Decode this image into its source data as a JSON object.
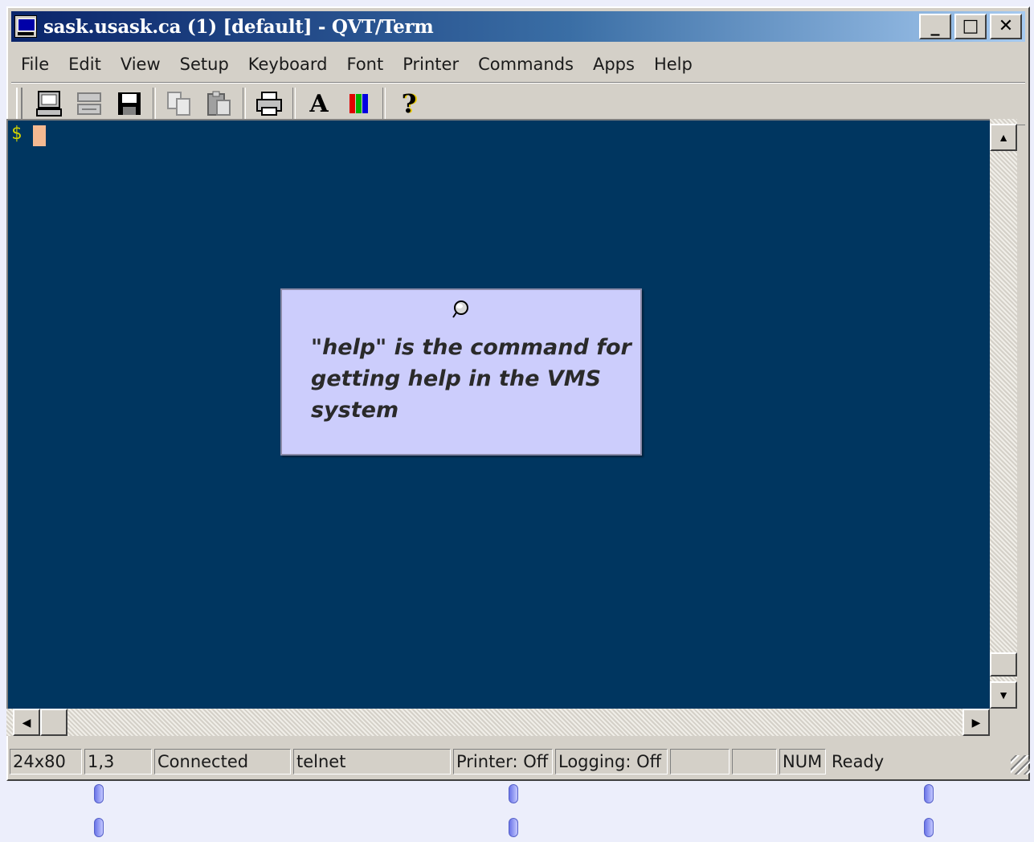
{
  "window": {
    "title": "sask.usask.ca (1) [default] - QVT/Term",
    "controls": {
      "minimize": "_",
      "maximize": "□",
      "close": "✕"
    }
  },
  "menu": [
    "File",
    "Edit",
    "View",
    "Setup",
    "Keyboard",
    "Font",
    "Printer",
    "Commands",
    "Apps",
    "Help"
  ],
  "toolbar": {
    "icons": [
      "terminal-icon",
      "keyboard-icon",
      "save-icon",
      "copy-icon",
      "paste-icon",
      "print-icon",
      "font-icon",
      "colors-icon",
      "help-icon"
    ],
    "font_label": "A",
    "help_label": "?"
  },
  "terminal": {
    "prompt": "$"
  },
  "callout": {
    "text": "\"help\" is the command for getting help in the VMS system"
  },
  "statusbar": {
    "size": "24x80",
    "position": "1,3",
    "connection": "Connected",
    "protocol": "telnet",
    "printer": "Printer: Off",
    "logging": "Logging: Off",
    "blank1": "",
    "blank2": "",
    "num": "NUM",
    "state": "Ready"
  },
  "colors": {
    "terminal_bg": "#003660",
    "callout_bg": "#cccdfc",
    "cursor": "#f4b991",
    "prompt": "#d2d200"
  }
}
